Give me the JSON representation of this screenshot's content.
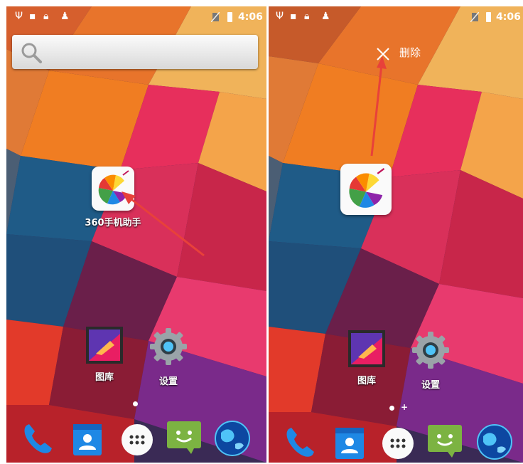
{
  "left_screen": {
    "status_time": "4:06",
    "app_shortcut": {
      "label": "360手机助手",
      "icon": "360-app-store-icon"
    },
    "apps": [
      {
        "label": "图库",
        "icon": "gallery-icon"
      },
      {
        "label": "设置",
        "icon": "settings-gear-icon"
      }
    ],
    "dock": [
      "phone-icon",
      "contacts-icon",
      "app-drawer-icon",
      "messaging-icon",
      "browser-globe-icon"
    ]
  },
  "right_screen": {
    "status_time": "4:06",
    "drop_target": {
      "label": "删除",
      "icon": "close-icon"
    },
    "dragged_app": {
      "icon": "360-app-store-icon"
    },
    "apps": [
      {
        "label": "图库",
        "icon": "gallery-icon"
      },
      {
        "label": "设置",
        "icon": "settings-gear-icon"
      }
    ],
    "page_indicator_plus": "+",
    "dock": [
      "phone-icon",
      "contacts-icon",
      "app-drawer-icon",
      "messaging-icon",
      "browser-globe-icon"
    ]
  },
  "colors": {
    "annotation_arrow": "#e8413a",
    "dock_phone": "#1e88e5",
    "dock_messaging": "#7cb342"
  }
}
